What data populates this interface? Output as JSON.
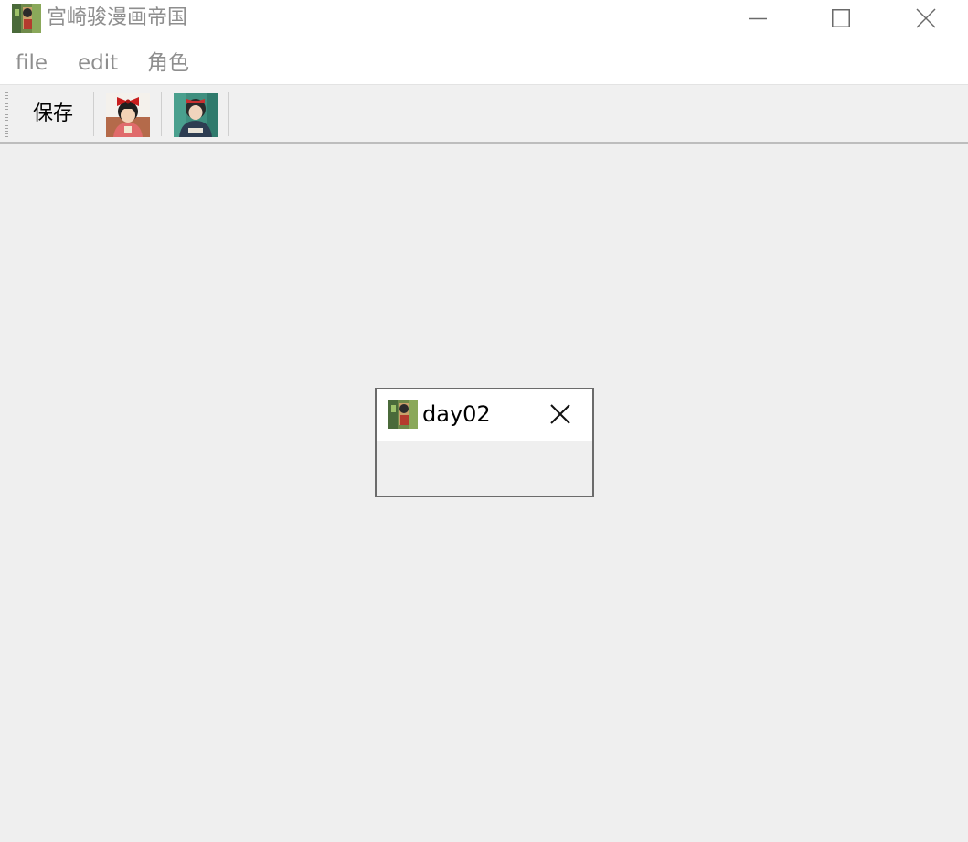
{
  "window": {
    "title": "宫崎骏漫画帝国",
    "app_icon": "kiki-window-icon",
    "controls": [
      "minimize-icon",
      "maximize-icon",
      "close-icon"
    ]
  },
  "menubar": {
    "items": [
      {
        "label": "file"
      },
      {
        "label": "edit"
      },
      {
        "label": "角色"
      }
    ]
  },
  "toolbar": {
    "save_label": "保存",
    "image_buttons": [
      "kiki-red-bow-icon",
      "kiki-dark-dress-icon"
    ]
  },
  "subwindow": {
    "title": "day02",
    "icon": "kiki-window-icon",
    "close_icon": "close-icon"
  },
  "colors": {
    "workspace_bg": "#efefef",
    "menu_text": "#8e8e8e",
    "border": "#6b6b6b"
  }
}
